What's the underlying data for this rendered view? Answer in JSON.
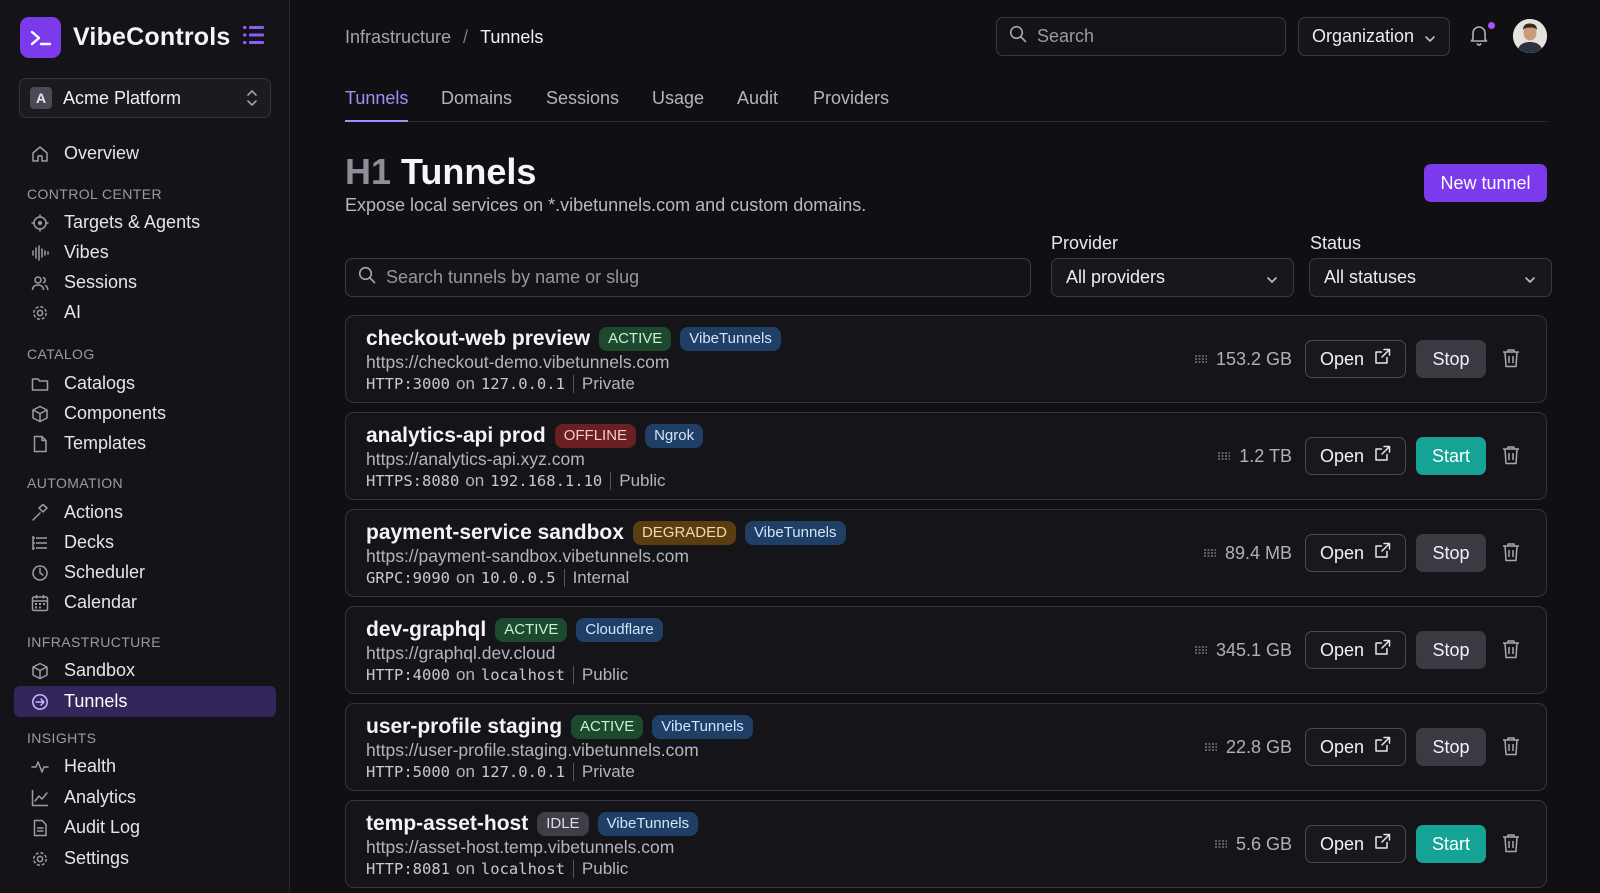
{
  "brand": {
    "name": "VibeControls"
  },
  "workspace": {
    "initial": "A",
    "name": "Acme Platform"
  },
  "nav": {
    "overview": "Overview",
    "sections": {
      "control_center": "CONTROL CENTER",
      "catalog": "CATALOG",
      "automation": "AUTOMATION",
      "infrastructure": "INFRASTRUCTURE",
      "insights": "INSIGHTS"
    },
    "items": {
      "targets": "Targets & Agents",
      "vibes": "Vibes",
      "sessions": "Sessions",
      "ai": "AI",
      "catalogs": "Catalogs",
      "components": "Components",
      "templates": "Templates",
      "actions": "Actions",
      "decks": "Decks",
      "scheduler": "Scheduler",
      "calendar": "Calendar",
      "sandbox": "Sandbox",
      "tunnels": "Tunnels",
      "health": "Health",
      "analytics": "Analytics",
      "audit_log": "Audit Log",
      "settings": "Settings"
    },
    "active": "Tunnels"
  },
  "header": {
    "breadcrumb": [
      "Infrastructure",
      "Tunnels"
    ],
    "breadcrumb_sep": "/",
    "search_placeholder": "Search",
    "org_label": "Organization"
  },
  "tabs": [
    "Tunnels",
    "Domains",
    "Sessions",
    "Usage",
    "Audit",
    "Providers"
  ],
  "page": {
    "title_prefix": "H1",
    "title": "Tunnels",
    "subtitle": "Expose local services on *.vibetunnels.com and custom domains.",
    "new_button": "New tunnel"
  },
  "filters": {
    "search_placeholder": "Search tunnels by name or slug",
    "provider_label": "Provider",
    "provider_value": "All providers",
    "status_label": "Status",
    "status_value": "All statuses"
  },
  "tunnels": [
    {
      "name": "checkout-web preview",
      "status": "ACTIVE",
      "provider": "VibeTunnels",
      "url": "https://checkout-demo.vibetunnels.com",
      "protocol": "HTTP:3000",
      "on": "on",
      "host": "127.0.0.1",
      "visibility": "Private",
      "usage": "153.2 GB",
      "open_label": "Open",
      "action": "Stop"
    },
    {
      "name": "analytics-api prod",
      "status": "OFFLINE",
      "provider": "Ngrok",
      "url": "https://analytics-api.xyz.com",
      "protocol": "HTTPS:8080",
      "on": "on",
      "host": "192.168.1.10",
      "visibility": "Public",
      "usage": "1.2 TB",
      "open_label": "Open",
      "action": "Start"
    },
    {
      "name": "payment-service sandbox",
      "status": "DEGRADED",
      "provider": "VibeTunnels",
      "url": "https://payment-sandbox.vibetunnels.com",
      "protocol": "GRPC:9090",
      "on": "on",
      "host": "10.0.0.5",
      "visibility": "Internal",
      "usage": "89.4 MB",
      "open_label": "Open",
      "action": "Stop"
    },
    {
      "name": "dev-graphql",
      "status": "ACTIVE",
      "provider": "Cloudflare",
      "url": "https://graphql.dev.cloud",
      "protocol": "HTTP:4000",
      "on": "on",
      "host": "localhost",
      "visibility": "Public",
      "usage": "345.1 GB",
      "open_label": "Open",
      "action": "Stop"
    },
    {
      "name": "user-profile staging",
      "status": "ACTIVE",
      "provider": "VibeTunnels",
      "url": "https://user-profile.staging.vibetunnels.com",
      "protocol": "HTTP:5000",
      "on": "on",
      "host": "127.0.0.1",
      "visibility": "Private",
      "usage": "22.8 GB",
      "open_label": "Open",
      "action": "Stop"
    },
    {
      "name": "temp-asset-host",
      "status": "IDLE",
      "provider": "VibeTunnels",
      "url": "https://asset-host.temp.vibetunnels.com",
      "protocol": "HTTP:8081",
      "on": "on",
      "host": "localhost",
      "visibility": "Public",
      "usage": "5.6 GB",
      "open_label": "Open",
      "action": "Start"
    }
  ],
  "colors": {
    "accent": "#7c3aed",
    "start": "#14a394",
    "active_badge": "#1d4a2e",
    "offline_badge": "#6a1f23",
    "degraded_badge": "#5c3d12",
    "idle_badge": "#3e3e46",
    "provider_badge": "#1f3f67"
  }
}
